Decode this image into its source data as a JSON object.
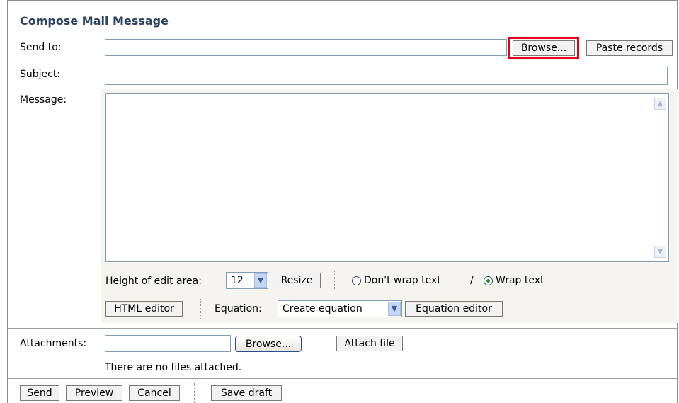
{
  "title": "Compose Mail Message",
  "send_to": {
    "label": "Send to:",
    "value": "",
    "browse_label": "Browse...",
    "paste_label": "Paste records"
  },
  "subject": {
    "label": "Subject:",
    "value": ""
  },
  "message": {
    "label": "Message:",
    "value": "",
    "height_label": "Height of edit area:",
    "height_value": "12",
    "resize_label": "Resize",
    "nowrap_label": "Don't wrap text",
    "separator": "/",
    "wrap_label": "Wrap text",
    "wrap_selected": true,
    "html_editor_label": "HTML editor",
    "equation_label": "Equation:",
    "equation_value": "Create equation",
    "equation_editor_label": "Equation editor"
  },
  "attachments": {
    "label": "Attachments:",
    "value": "",
    "browse_label": "Browse...",
    "attach_label": "Attach file",
    "status": "There are no files attached."
  },
  "actions": {
    "send": "Send",
    "preview": "Preview",
    "cancel": "Cancel",
    "save_draft": "Save draft"
  },
  "icons": {
    "scroll_up": "scroll-up-icon",
    "scroll_down": "scroll-down-icon",
    "dropdown": "chevron-down-icon"
  },
  "colors": {
    "title": "#2b4263",
    "highlight": "#e0001a",
    "panel": "#f5f4ee",
    "field_border": "#7f9db9"
  }
}
